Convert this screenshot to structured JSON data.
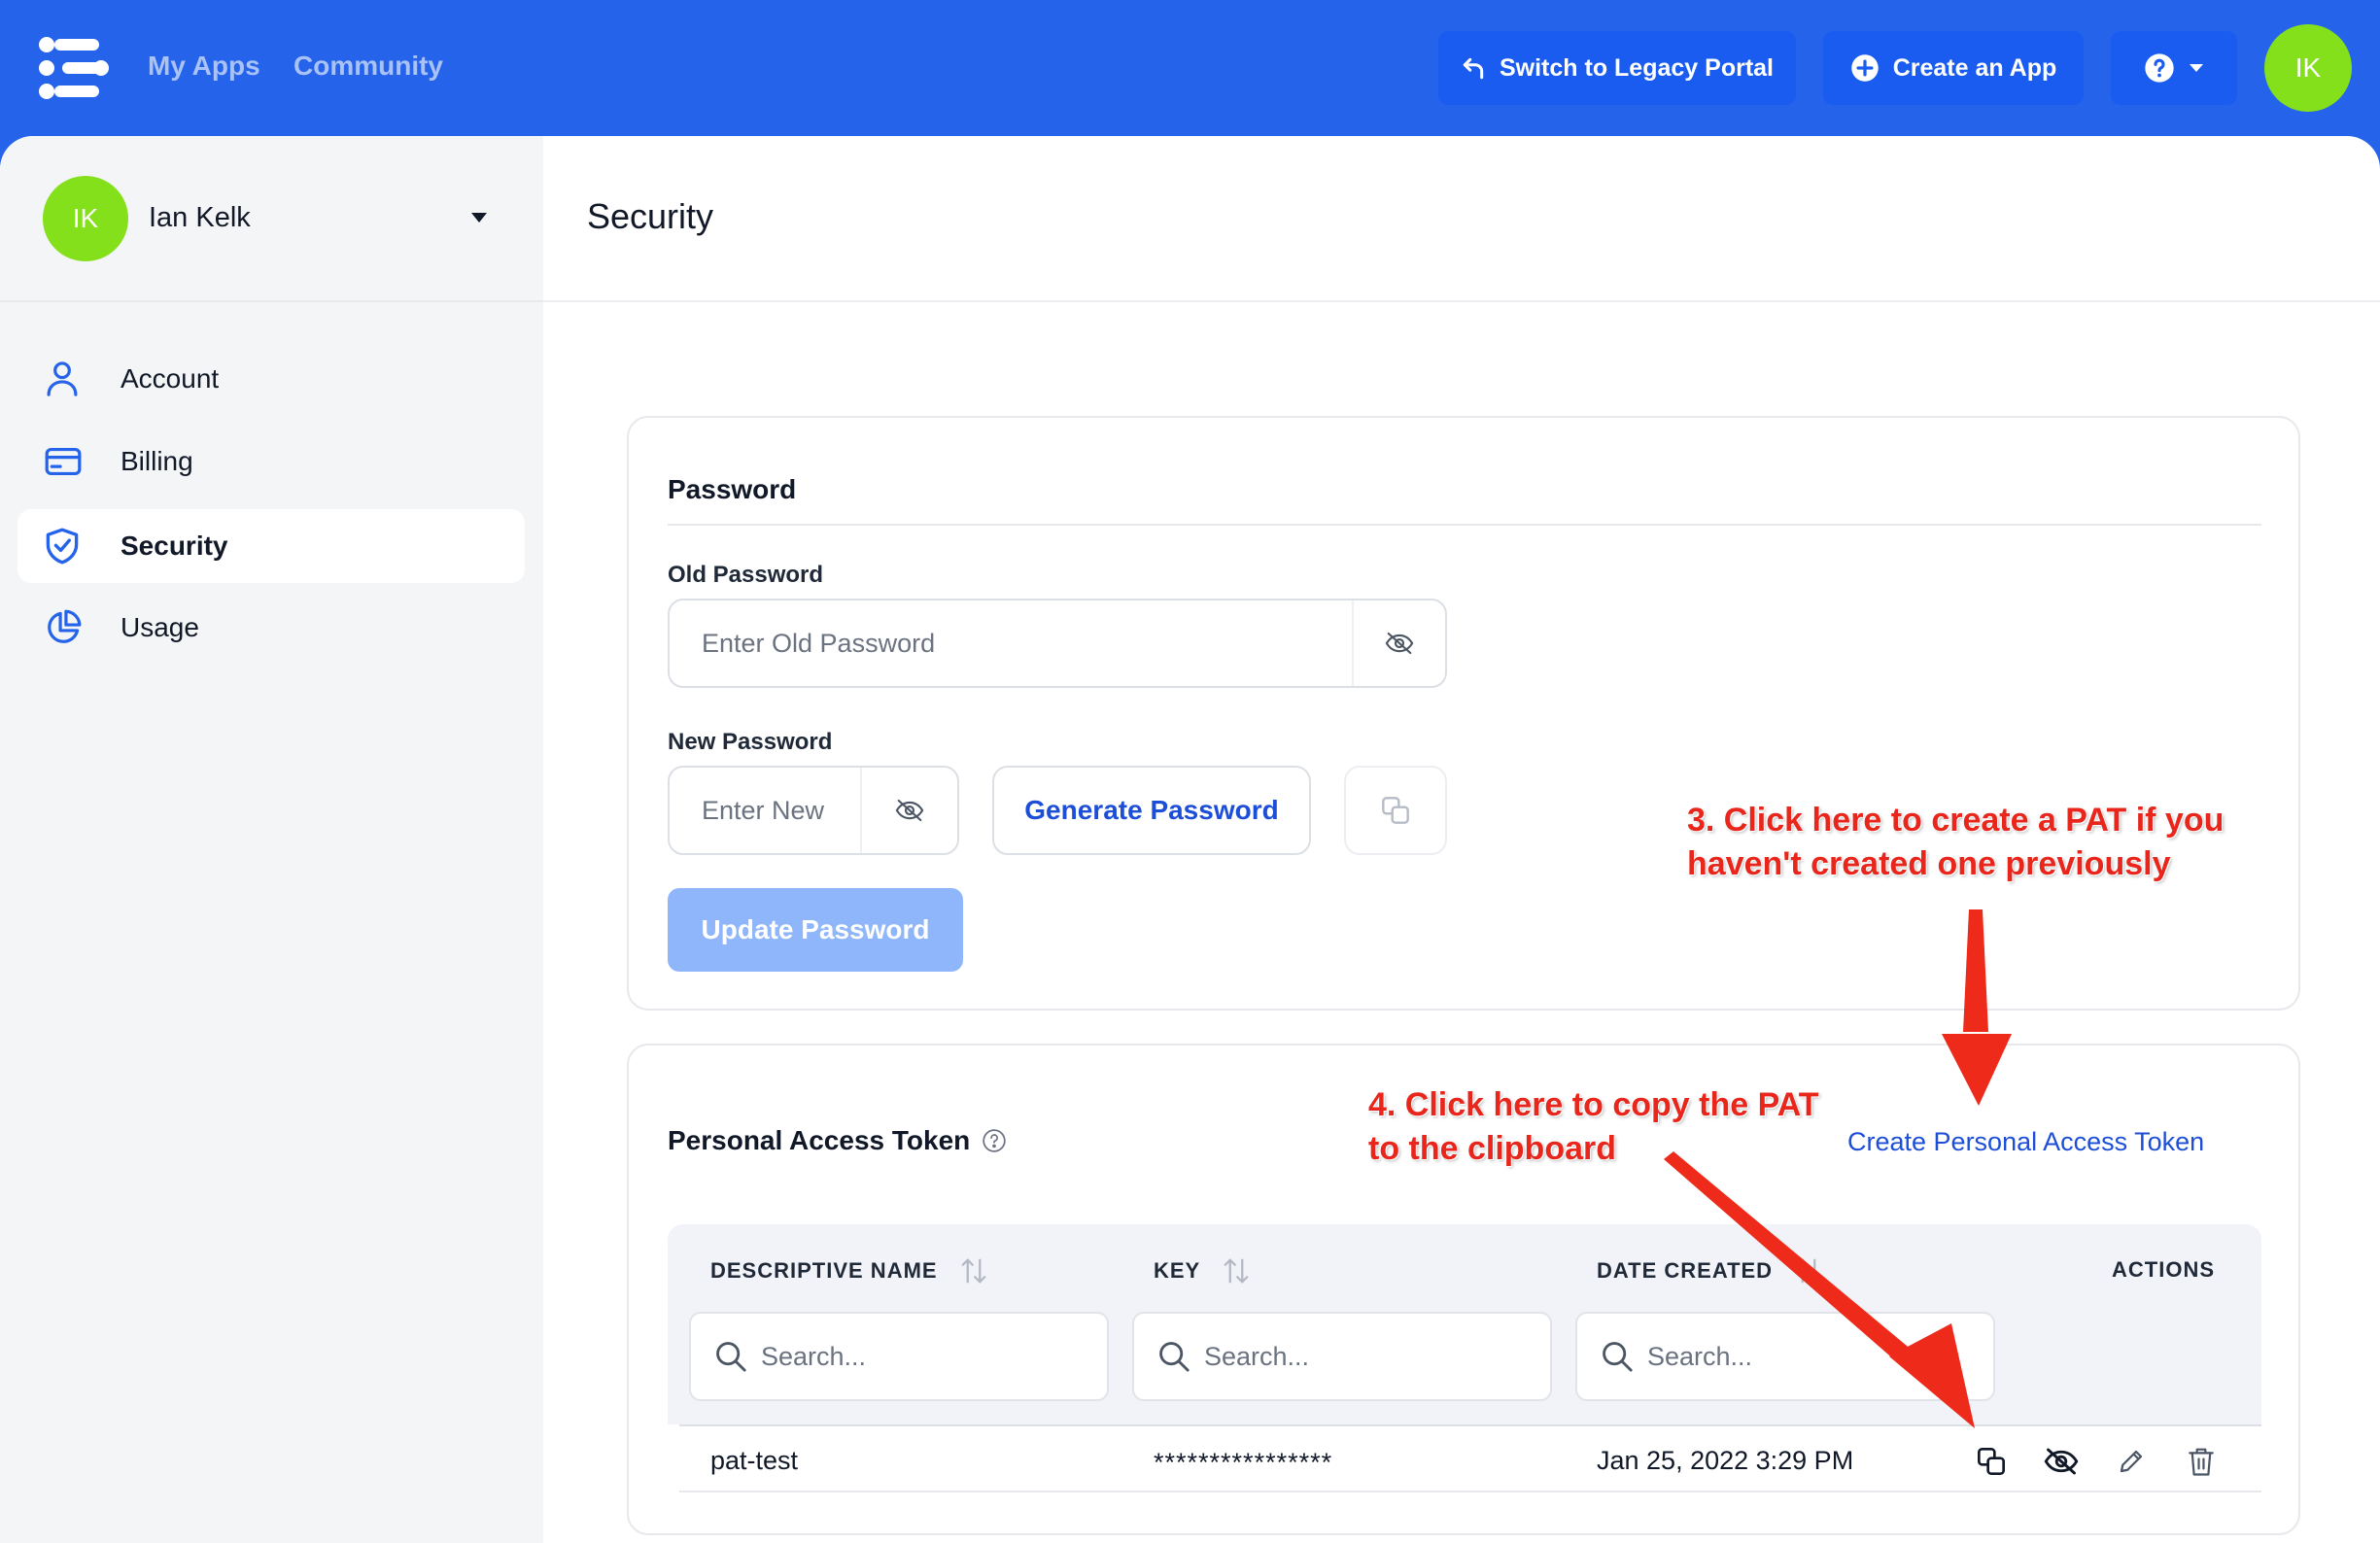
{
  "topbar": {
    "nav": {
      "my_apps": "My Apps",
      "community": "Community"
    },
    "legacy_button": "Switch to Legacy Portal",
    "create_app_button": "Create an App",
    "avatar_initials": "IK"
  },
  "sidebar": {
    "user": {
      "initials": "IK",
      "name": "Ian Kelk"
    },
    "items": [
      {
        "label": "Account",
        "icon": "user-icon"
      },
      {
        "label": "Billing",
        "icon": "credit-card-icon"
      },
      {
        "label": "Security",
        "icon": "shield-check-icon",
        "active": true
      },
      {
        "label": "Usage",
        "icon": "pie-chart-icon"
      }
    ]
  },
  "page": {
    "title": "Security"
  },
  "password": {
    "title": "Password",
    "old_label": "Old Password",
    "old_placeholder": "Enter Old Password",
    "new_label": "New Password",
    "new_placeholder": "Enter New",
    "generate_button": "Generate Password",
    "update_button": "Update Password"
  },
  "pat": {
    "title": "Personal Access Token",
    "create_link": "Create Personal Access Token",
    "columns": {
      "name": "DESCRIPTIVE NAME",
      "key": "KEY",
      "date": "DATE CREATED",
      "actions": "ACTIONS"
    },
    "search_placeholder": "Search...",
    "rows": [
      {
        "name": "pat-test",
        "key": "****************",
        "date": "Jan 25, 2022 3:29 PM"
      }
    ]
  },
  "annotations": {
    "step3": "3. Click here to create a PAT if you haven't created one previously",
    "step4": "4. Click here to copy the PAT to the clipboard"
  },
  "colors": {
    "brand": "#2563eb",
    "accent": "#1d4ed8",
    "avatar": "#84e01b",
    "annotation": "#e8261c"
  }
}
